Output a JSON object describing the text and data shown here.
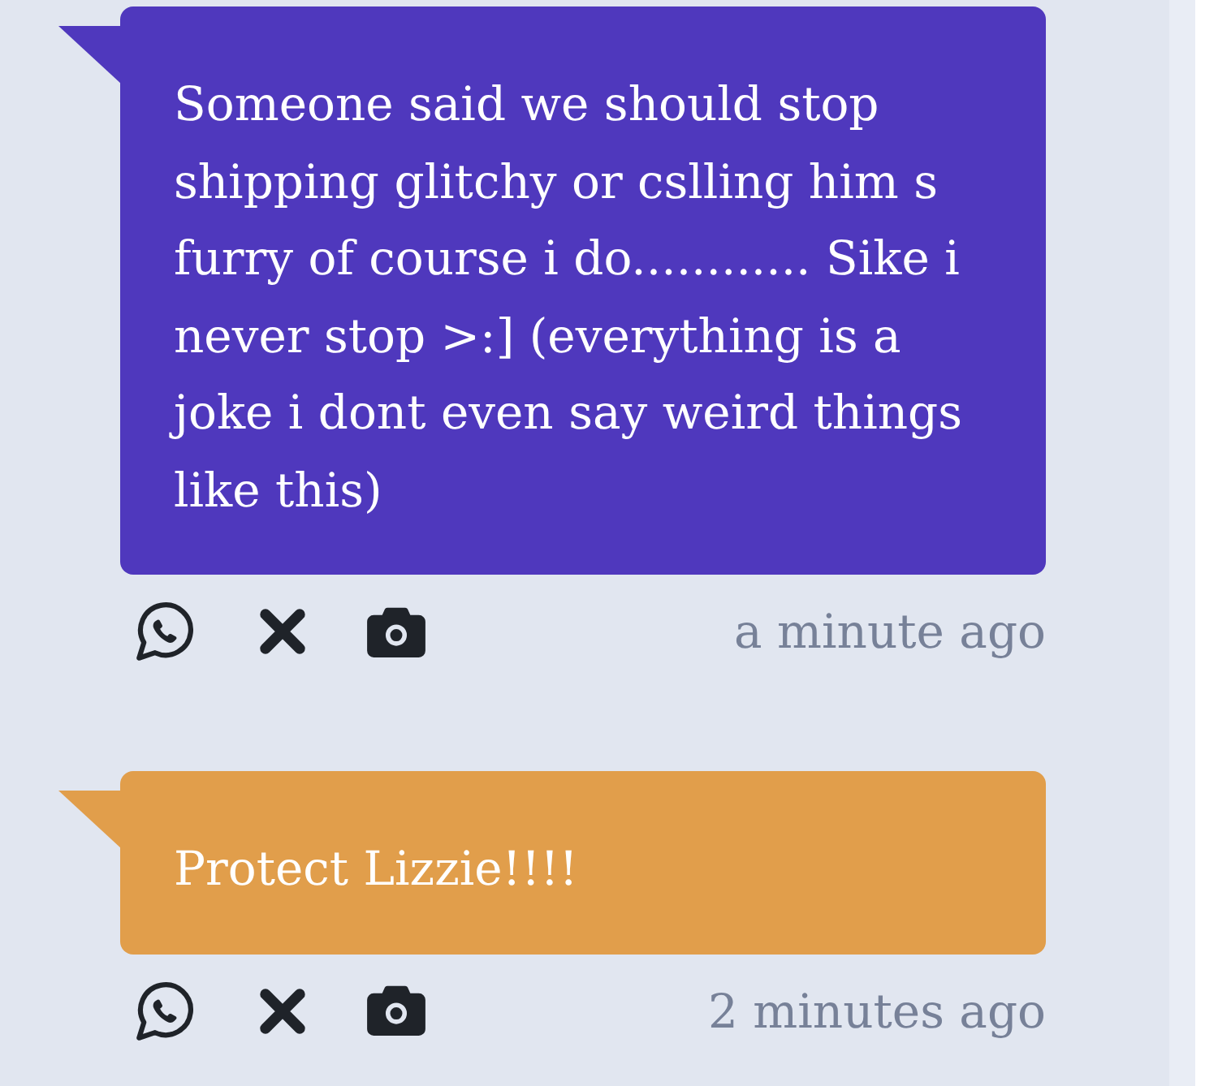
{
  "messages": [
    {
      "text": "Someone said we should stop shipping glitchy or cslling him s furry of course i do............ Sike i never stop >:] (everything is a joke i dont even say weird things like this)",
      "color": "#4f38bd",
      "time": "a minute ago"
    },
    {
      "text": "Protect Lizzie!!!!",
      "color": "#e19e4b",
      "time": "2 minutes ago"
    }
  ]
}
